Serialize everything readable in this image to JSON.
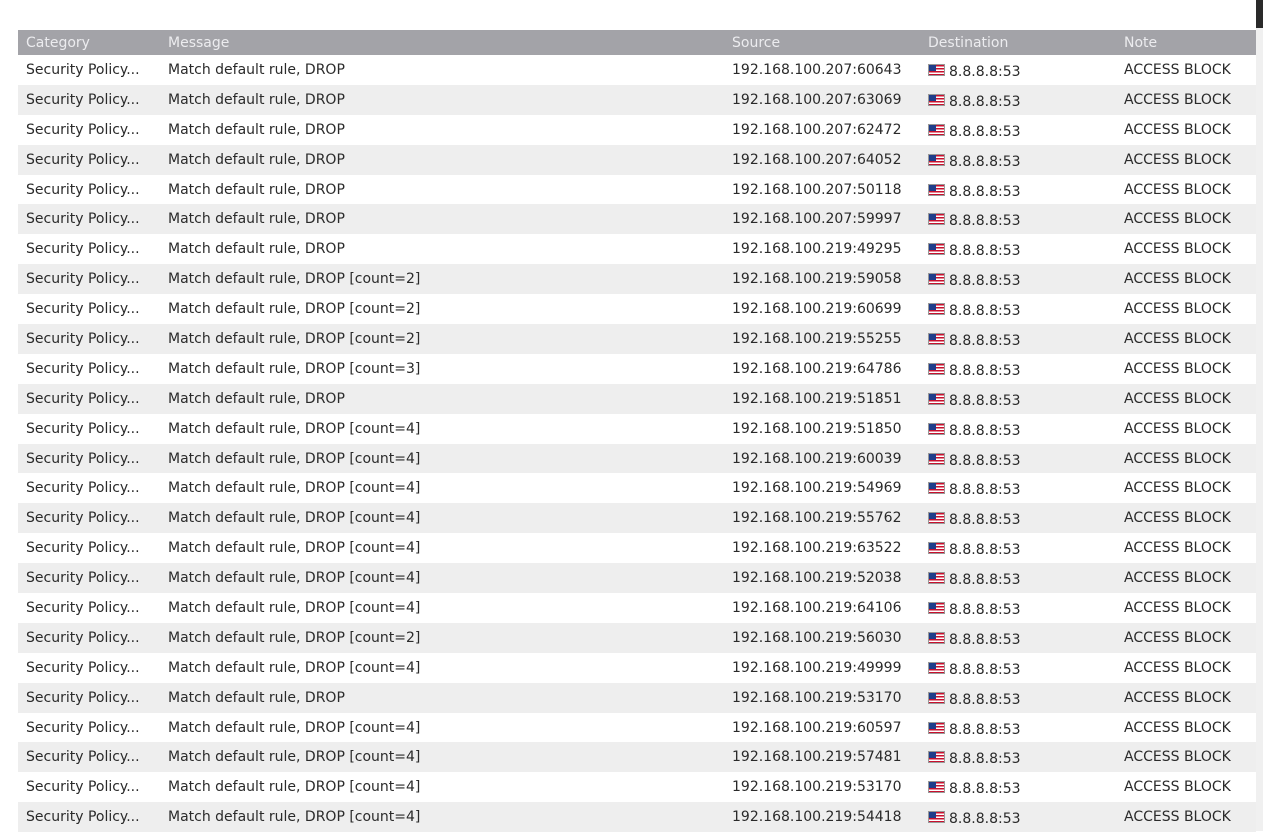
{
  "table": {
    "headers": {
      "category": "Category",
      "message": "Message",
      "source": "Source",
      "destination": "Destination",
      "note": "Note"
    },
    "rows": [
      {
        "category": "Security Policy...",
        "message": "Match default rule, DROP",
        "source": "192.168.100.207:60643",
        "destination": "8.8.8.8:53",
        "note": "ACCESS BLOCK",
        "flag": "us-flag-icon"
      },
      {
        "category": "Security Policy...",
        "message": "Match default rule, DROP",
        "source": "192.168.100.207:63069",
        "destination": "8.8.8.8:53",
        "note": "ACCESS BLOCK",
        "flag": "us-flag-icon"
      },
      {
        "category": "Security Policy...",
        "message": "Match default rule, DROP",
        "source": "192.168.100.207:62472",
        "destination": "8.8.8.8:53",
        "note": "ACCESS BLOCK",
        "flag": "us-flag-icon"
      },
      {
        "category": "Security Policy...",
        "message": "Match default rule, DROP",
        "source": "192.168.100.207:64052",
        "destination": "8.8.8.8:53",
        "note": "ACCESS BLOCK",
        "flag": "us-flag-icon"
      },
      {
        "category": "Security Policy...",
        "message": "Match default rule, DROP",
        "source": "192.168.100.207:50118",
        "destination": "8.8.8.8:53",
        "note": "ACCESS BLOCK",
        "flag": "us-flag-icon"
      },
      {
        "category": "Security Policy...",
        "message": "Match default rule, DROP",
        "source": "192.168.100.207:59997",
        "destination": "8.8.8.8:53",
        "note": "ACCESS BLOCK",
        "flag": "us-flag-icon"
      },
      {
        "category": "Security Policy...",
        "message": "Match default rule, DROP",
        "source": "192.168.100.219:49295",
        "destination": "8.8.8.8:53",
        "note": "ACCESS BLOCK",
        "flag": "us-flag-icon"
      },
      {
        "category": "Security Policy...",
        "message": "Match default rule, DROP [count=2]",
        "source": "192.168.100.219:59058",
        "destination": "8.8.8.8:53",
        "note": "ACCESS BLOCK",
        "flag": "us-flag-icon"
      },
      {
        "category": "Security Policy...",
        "message": "Match default rule, DROP [count=2]",
        "source": "192.168.100.219:60699",
        "destination": "8.8.8.8:53",
        "note": "ACCESS BLOCK",
        "flag": "us-flag-icon"
      },
      {
        "category": "Security Policy...",
        "message": "Match default rule, DROP [count=2]",
        "source": "192.168.100.219:55255",
        "destination": "8.8.8.8:53",
        "note": "ACCESS BLOCK",
        "flag": "us-flag-icon"
      },
      {
        "category": "Security Policy...",
        "message": "Match default rule, DROP [count=3]",
        "source": "192.168.100.219:64786",
        "destination": "8.8.8.8:53",
        "note": "ACCESS BLOCK",
        "flag": "us-flag-icon"
      },
      {
        "category": "Security Policy...",
        "message": "Match default rule, DROP",
        "source": "192.168.100.219:51851",
        "destination": "8.8.8.8:53",
        "note": "ACCESS BLOCK",
        "flag": "us-flag-icon"
      },
      {
        "category": "Security Policy...",
        "message": "Match default rule, DROP [count=4]",
        "source": "192.168.100.219:51850",
        "destination": "8.8.8.8:53",
        "note": "ACCESS BLOCK",
        "flag": "us-flag-icon"
      },
      {
        "category": "Security Policy...",
        "message": "Match default rule, DROP [count=4]",
        "source": "192.168.100.219:60039",
        "destination": "8.8.8.8:53",
        "note": "ACCESS BLOCK",
        "flag": "us-flag-icon"
      },
      {
        "category": "Security Policy...",
        "message": "Match default rule, DROP [count=4]",
        "source": "192.168.100.219:54969",
        "destination": "8.8.8.8:53",
        "note": "ACCESS BLOCK",
        "flag": "us-flag-icon"
      },
      {
        "category": "Security Policy...",
        "message": "Match default rule, DROP [count=4]",
        "source": "192.168.100.219:55762",
        "destination": "8.8.8.8:53",
        "note": "ACCESS BLOCK",
        "flag": "us-flag-icon"
      },
      {
        "category": "Security Policy...",
        "message": "Match default rule, DROP [count=4]",
        "source": "192.168.100.219:63522",
        "destination": "8.8.8.8:53",
        "note": "ACCESS BLOCK",
        "flag": "us-flag-icon"
      },
      {
        "category": "Security Policy...",
        "message": "Match default rule, DROP [count=4]",
        "source": "192.168.100.219:52038",
        "destination": "8.8.8.8:53",
        "note": "ACCESS BLOCK",
        "flag": "us-flag-icon"
      },
      {
        "category": "Security Policy...",
        "message": "Match default rule, DROP [count=4]",
        "source": "192.168.100.219:64106",
        "destination": "8.8.8.8:53",
        "note": "ACCESS BLOCK",
        "flag": "us-flag-icon"
      },
      {
        "category": "Security Policy...",
        "message": "Match default rule, DROP [count=2]",
        "source": "192.168.100.219:56030",
        "destination": "8.8.8.8:53",
        "note": "ACCESS BLOCK",
        "flag": "us-flag-icon"
      },
      {
        "category": "Security Policy...",
        "message": "Match default rule, DROP [count=4]",
        "source": "192.168.100.219:49999",
        "destination": "8.8.8.8:53",
        "note": "ACCESS BLOCK",
        "flag": "us-flag-icon"
      },
      {
        "category": "Security Policy...",
        "message": "Match default rule, DROP",
        "source": "192.168.100.219:53170",
        "destination": "8.8.8.8:53",
        "note": "ACCESS BLOCK",
        "flag": "us-flag-icon"
      },
      {
        "category": "Security Policy...",
        "message": "Match default rule, DROP [count=4]",
        "source": "192.168.100.219:60597",
        "destination": "8.8.8.8:53",
        "note": "ACCESS BLOCK",
        "flag": "us-flag-icon"
      },
      {
        "category": "Security Policy...",
        "message": "Match default rule, DROP [count=4]",
        "source": "192.168.100.219:57481",
        "destination": "8.8.8.8:53",
        "note": "ACCESS BLOCK",
        "flag": "us-flag-icon"
      },
      {
        "category": "Security Policy...",
        "message": "Match default rule, DROP [count=4]",
        "source": "192.168.100.219:53170",
        "destination": "8.8.8.8:53",
        "note": "ACCESS BLOCK",
        "flag": "us-flag-icon"
      },
      {
        "category": "Security Policy...",
        "message": "Match default rule, DROP [count=4]",
        "source": "192.168.100.219:54418",
        "destination": "8.8.8.8:53",
        "note": "ACCESS BLOCK",
        "flag": "us-flag-icon"
      }
    ]
  },
  "colors": {
    "header_bg": "#a3a3a8",
    "header_text": "#ececef",
    "row_alt": "#eeeeee",
    "row": "#ffffff"
  }
}
